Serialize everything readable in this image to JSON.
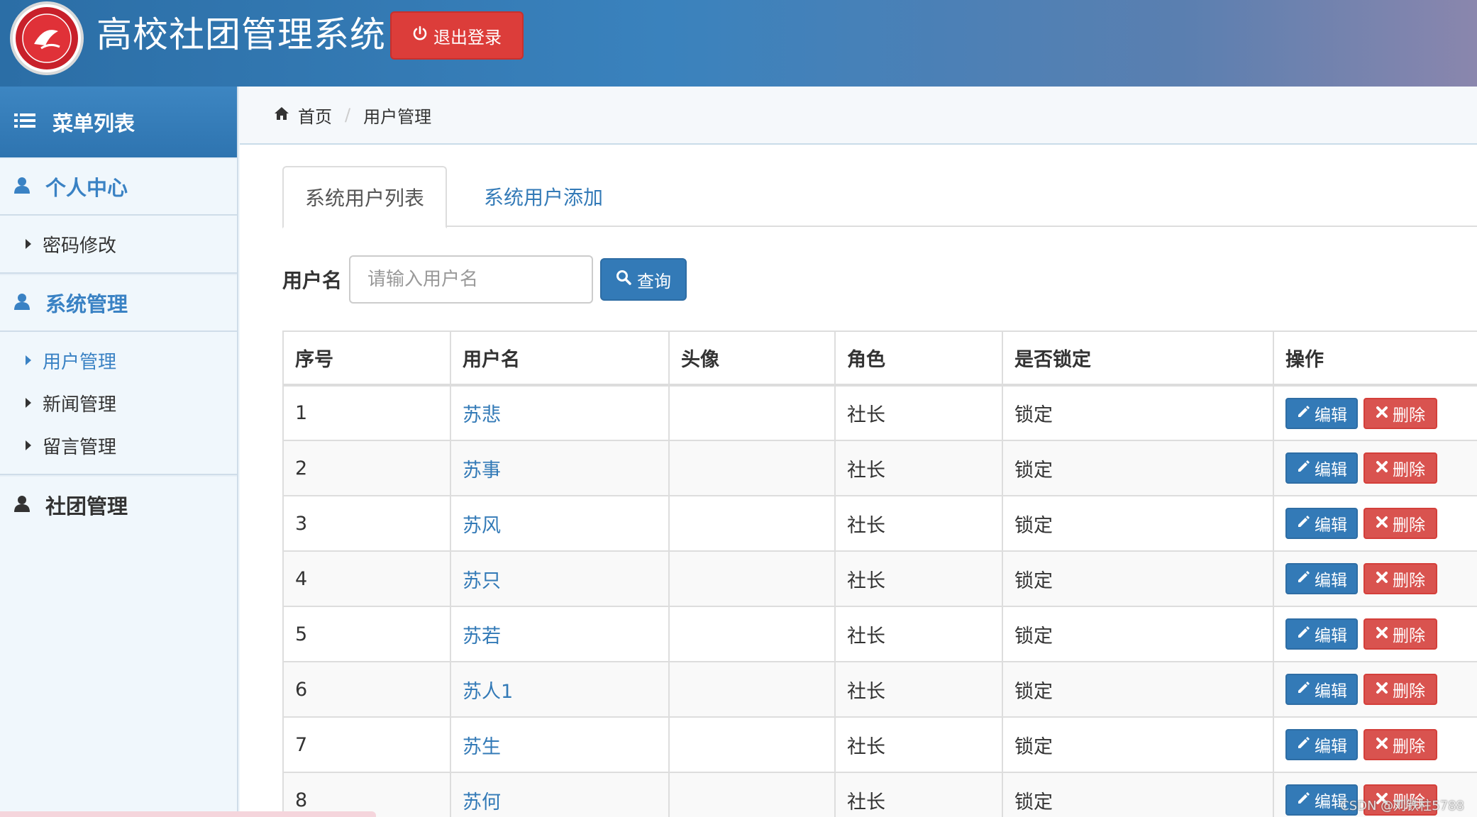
{
  "header": {
    "title": "高校社团管理系统",
    "logout_label": "退出登录"
  },
  "sidebar": {
    "menu_title": "菜单列表",
    "groups": [
      {
        "label": "个人中心",
        "items": [
          {
            "label": "密码修改"
          }
        ]
      },
      {
        "label": "系统管理",
        "items": [
          {
            "label": "用户管理"
          },
          {
            "label": "新闻管理"
          },
          {
            "label": "留言管理"
          }
        ]
      },
      {
        "label": "社团管理",
        "items": []
      }
    ]
  },
  "breadcrumb": {
    "home": "首页",
    "current": "用户管理"
  },
  "tabs": {
    "list": "系统用户列表",
    "add": "系统用户添加"
  },
  "search": {
    "label": "用户名",
    "placeholder": "请输入用户名",
    "button": "查询"
  },
  "table": {
    "headers": [
      "序号",
      "用户名",
      "头像",
      "角色",
      "是否锁定",
      "操作"
    ],
    "edit_label": "编辑",
    "delete_label": "删除",
    "rows": [
      {
        "no": "1",
        "name": "苏悲",
        "avatar": "",
        "role": "社长",
        "locked": "锁定"
      },
      {
        "no": "2",
        "name": "苏事",
        "avatar": "",
        "role": "社长",
        "locked": "锁定"
      },
      {
        "no": "3",
        "name": "苏风",
        "avatar": "",
        "role": "社长",
        "locked": "锁定"
      },
      {
        "no": "4",
        "name": "苏只",
        "avatar": "",
        "role": "社长",
        "locked": "锁定"
      },
      {
        "no": "5",
        "name": "苏若",
        "avatar": "",
        "role": "社长",
        "locked": "锁定"
      },
      {
        "no": "6",
        "name": "苏人1",
        "avatar": "",
        "role": "社长",
        "locked": "锁定"
      },
      {
        "no": "7",
        "name": "苏生",
        "avatar": "",
        "role": "社长",
        "locked": "锁定"
      },
      {
        "no": "8",
        "name": "苏何",
        "avatar": "",
        "role": "社长",
        "locked": "锁定"
      }
    ]
  },
  "watermark": "CSDN @刘铁柱5788",
  "colors": {
    "primary": "#337ab7",
    "danger": "#d9534f",
    "logout": "#dc3d3a",
    "sidebar_active": "#3a82c4"
  }
}
